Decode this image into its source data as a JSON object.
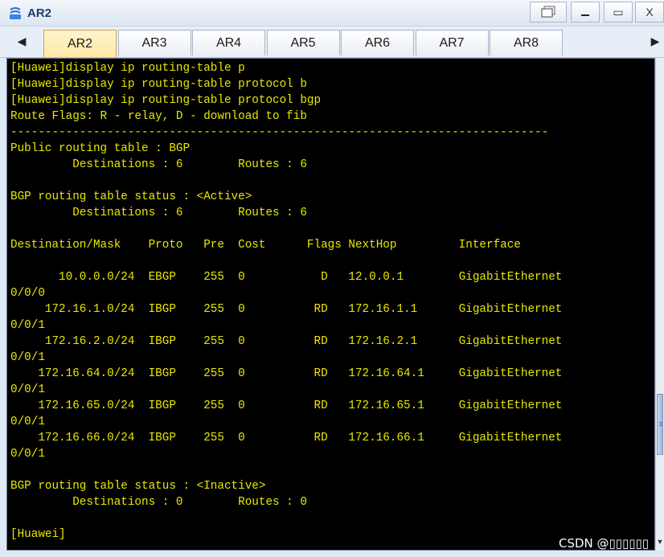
{
  "window": {
    "title": "AR2",
    "icon": "router-console-icon",
    "buttons": [
      "restore-window-icon",
      "minimize-icon",
      "maximize-icon",
      "close-icon"
    ],
    "maximize_glyph": "▭",
    "close_glyph": "X"
  },
  "tabs": {
    "items": [
      "AR2",
      "AR3",
      "AR4",
      "AR5",
      "AR6",
      "AR7",
      "AR8"
    ],
    "active": "AR2",
    "left_arrow": "◀",
    "right_arrow": "▶"
  },
  "terminal": {
    "text_color": "#e8e800",
    "background": "#000000",
    "lines": [
      "[Huawei]display ip routing-table p",
      "[Huawei]display ip routing-table protocol b",
      "[Huawei]display ip routing-table protocol bgp",
      "Route Flags: R - relay, D - download to fib",
      "------------------------------------------------------------------------------",
      "Public routing table : BGP",
      "         Destinations : 6        Routes : 6",
      "",
      "BGP routing table status : <Active>",
      "         Destinations : 6        Routes : 6",
      "",
      "Destination/Mask    Proto   Pre  Cost      Flags NextHop         Interface",
      "",
      "       10.0.0.0/24  EBGP    255  0           D   12.0.0.1        GigabitEthernet",
      "0/0/0",
      "     172.16.1.0/24  IBGP    255  0          RD   172.16.1.1      GigabitEthernet",
      "0/0/1",
      "     172.16.2.0/24  IBGP    255  0          RD   172.16.2.1      GigabitEthernet",
      "0/0/1",
      "    172.16.64.0/24  IBGP    255  0          RD   172.16.64.1     GigabitEthernet",
      "0/0/1",
      "    172.16.65.0/24  IBGP    255  0          RD   172.16.65.1     GigabitEthernet",
      "0/0/1",
      "    172.16.66.0/24  IBGP    255  0          RD   172.16.66.1     GigabitEthernet",
      "0/0/1",
      "",
      "BGP routing table status : <Inactive>",
      "         Destinations : 0        Routes : 0",
      "",
      "[Huawei]"
    ]
  },
  "watermark": "CSDN @▯▯▯▯▯▯"
}
